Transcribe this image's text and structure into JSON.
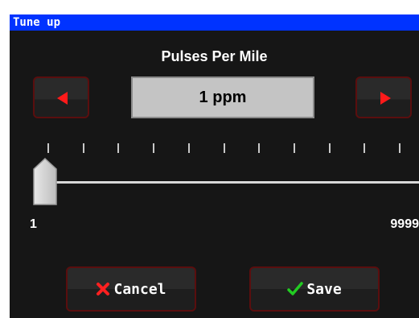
{
  "window": {
    "title": "Tune up"
  },
  "setting": {
    "label": "Pulses Per Mile",
    "value": "1 ppm"
  },
  "slider": {
    "min": "1",
    "max": "9999",
    "level": 0
  },
  "actions": {
    "cancel_label": "Cancel",
    "save_label": "Save"
  },
  "icons": {
    "decrement": "triangle-left-icon",
    "increment": "triangle-right-icon",
    "cancel": "x-icon",
    "save": "checkmark-icon"
  },
  "colors": {
    "titlebar": "#0033ff",
    "background": "#161616",
    "arrow": "#ff1a1a",
    "cancel_icon": "#ff2020",
    "save_icon": "#22cc22"
  }
}
